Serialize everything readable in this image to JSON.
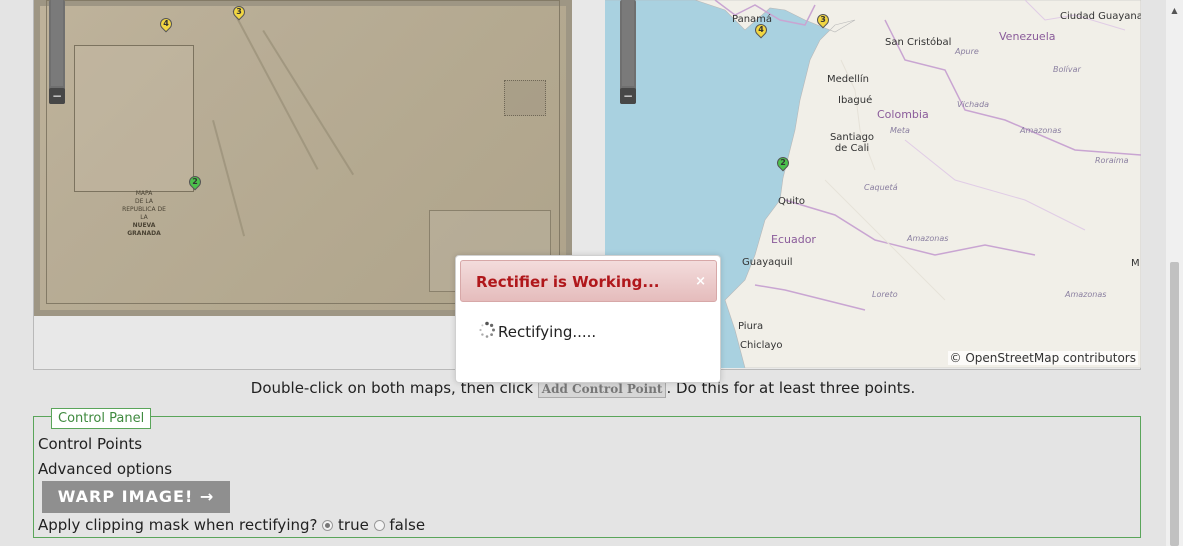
{
  "maps": {
    "left": {
      "old_map_title_lines": [
        "MAPA",
        "DE LA REPUBLICA DE LA",
        "NUEVA GRANADA"
      ],
      "markers": [
        "4",
        "3",
        "2"
      ]
    },
    "right": {
      "places": {
        "panama": "Panamá",
        "san_cristobal": "San Cristóbal",
        "ciudad_guayana": "Ciudad Guayana",
        "medellin": "Medellín",
        "ibague": "Ibagué",
        "santiago_de_cali": "Santiago de Cali",
        "quito": "Quito",
        "guayaquil": "Guayaquil",
        "piura": "Piura",
        "chiclayo": "Chiclayo"
      },
      "countries": {
        "venezuela": "Venezuela",
        "colombia": "Colombia",
        "ecuador": "Ecuador"
      },
      "regions": {
        "apure": "Apure",
        "bolivar": "Bolívar",
        "vichada": "Vichada",
        "meta": "Meta",
        "amazonas1": "Amazonas",
        "roraima": "Roraima",
        "caqueta": "Caquetá",
        "amazonas2": "Amazonas",
        "loreto": "Loreto",
        "amazonas3": "Amazonas",
        "m": "M"
      },
      "markers": [
        "4",
        "3",
        "2"
      ],
      "credit": "© OpenStreetMap contributors"
    },
    "zoom_minus": "−"
  },
  "instructions": {
    "before": "Double-click on both maps, then click ",
    "button": "Add Control Point",
    "after": ". Do this for at least three points."
  },
  "control_panel": {
    "legend": "Control Panel",
    "control_points": "Control Points",
    "advanced_options": "Advanced options",
    "warp_button": "WARP IMAGE! →",
    "clip_label": "Apply clipping mask when rectifying?",
    "clip_true": "true",
    "clip_false": "false",
    "clip_selected": "true"
  },
  "dialog": {
    "title": "Rectifier is Working...",
    "close": "×",
    "body": "Rectifying....."
  },
  "colors": {
    "dialog_title": "#b0171b",
    "panel_border": "#5aa55a",
    "warp_button": "#8f8f8f"
  }
}
